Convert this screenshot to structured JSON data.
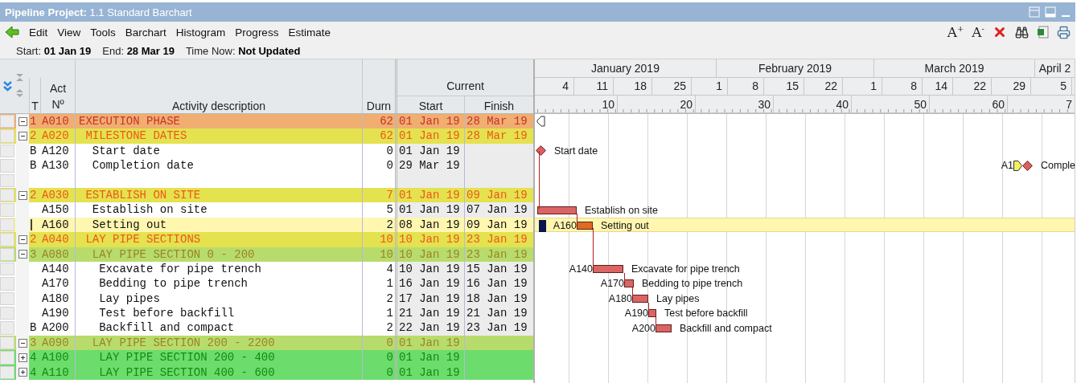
{
  "window": {
    "title": "**Pipeline Project:** 1.1 Standard Barchart"
  },
  "menu": [
    "Edit",
    "View",
    "Tools",
    "Barchart",
    "Histogram",
    "Progress",
    "Estimate"
  ],
  "toolbar": [
    {
      "kind": "text",
      "label": "A$^{+}$"
    },
    {
      "kind": "text",
      "label": "A$^{-}$"
    },
    {
      "kind": "delete"
    },
    {
      "kind": "find"
    },
    {
      "kind": "excel"
    },
    {
      "kind": "print"
    }
  ],
  "info": [
    {
      "label": "Start:",
      "value": "01 Jan 19"
    },
    {
      "label": "End:",
      "value": "28 Mar 19"
    },
    {
      "label": "Time Now:",
      "value": "Not Updated"
    }
  ],
  "table": {
    "columns": {
      "t": "T",
      "act": [
        "Act",
        "Nº"
      ],
      "description": "Activity description",
      "durn": "Durn",
      "group": "Current",
      "start": "Start",
      "finish": "Finish"
    }
  },
  "rows": [
    {
      "kind": "phase",
      "expanded": true,
      "selected": false,
      "t": "1",
      "act": "A010",
      "description": "EXECUTION PHASE",
      "durn": "62",
      "start": "01 Jan 19",
      "finish": "28 Mar 19",
      "bar": {
        "kind": "summary-start"
      },
      "children": [
        {
          "kind": "group",
          "expanded": true,
          "selected": false,
          "t": "2",
          "act": "A020",
          "description": "MILESTONE DATES",
          "durn": "62",
          "start": "01 Jan 19",
          "finish": "28 Mar 19",
          "children": [
            {
              "kind": "activity",
              "selected": false,
              "t": "B",
              "act": "A120",
              "description": "Start date",
              "durn": "0",
              "start": "01 Jan 19",
              "bar": {
                "kind": "milestone",
                "right_label": "Start date"
              }
            },
            {
              "kind": "activity",
              "selected": false,
              "t": "B",
              "act": "A130",
              "description": "Completion date",
              "durn": "0",
              "start": "29 Mar 19",
              "bar": {
                "kind": "late-milestone",
                "left_label": "A1",
                "right_label": "Comple"
              }
            }
          ]
        },
        {
          "kind": "blank",
          "selected": false
        },
        {
          "kind": "group",
          "expanded": true,
          "selected": false,
          "t": "2",
          "act": "A030",
          "description": "ESTABLISH ON SITE",
          "durn": "7",
          "start": "01 Jan 19",
          "finish": "09 Jan 19",
          "children": [
            {
              "kind": "activity",
              "selected": false,
              "act": "A150",
              "description": "Establish on site",
              "durn": "5",
              "start": "01 Jan 19",
              "finish": "07 Jan 19",
              "bar": {
                "kind": "bar",
                "right_label": "Establish on site"
              }
            },
            {
              "kind": "activity",
              "selected": true,
              "act": "A160",
              "description": "Setting out",
              "durn": "2",
              "start": "08 Jan 19",
              "finish": "09 Jan 19",
              "bar": {
                "kind": "progress-bar",
                "left_label": "A160",
                "right_label": "Setting out"
              }
            }
          ]
        },
        {
          "kind": "group",
          "expanded": true,
          "selected": false,
          "t": "2",
          "act": "A040",
          "description": "LAY PIPE SECTIONS",
          "durn": "10",
          "start": "10 Jan 19",
          "finish": "23 Jan 19",
          "children": [
            {
              "kind": "section",
              "expanded": true,
              "selected": false,
              "t": "3",
              "act": "A080",
              "description": "LAY PIPE SECTION 0 - 200",
              "durn": "10",
              "start": "10 Jan 19",
              "finish": "23 Jan 19",
              "children": [
                {
                  "kind": "activity",
                  "selected": false,
                  "act": "A140",
                  "description": "Excavate for pipe trench",
                  "durn": "4",
                  "start": "10 Jan 19",
                  "finish": "15 Jan 19",
                  "bar": {
                    "kind": "bar",
                    "left_label": "A140",
                    "right_label": "Excavate for pipe trench"
                  }
                },
                {
                  "kind": "activity",
                  "selected": false,
                  "act": "A170",
                  "description": "Bedding to pipe trench",
                  "durn": "1",
                  "start": "16 Jan 19",
                  "finish": "16 Jan 19",
                  "bar": {
                    "kind": "bar",
                    "left_label": "A170",
                    "right_label": "Bedding to pipe trench"
                  }
                },
                {
                  "kind": "activity",
                  "selected": false,
                  "act": "A180",
                  "description": "Lay pipes",
                  "durn": "2",
                  "start": "17 Jan 19",
                  "finish": "18 Jan 19",
                  "bar": {
                    "kind": "bar",
                    "left_label": "A180",
                    "right_label": "Lay pipes"
                  }
                },
                {
                  "kind": "activity",
                  "selected": false,
                  "act": "A190",
                  "description": "Test before backfill",
                  "durn": "1",
                  "start": "21 Jan 19",
                  "finish": "21 Jan 19",
                  "bar": {
                    "kind": "bar",
                    "left_label": "A190",
                    "right_label": "Test before backfill"
                  }
                },
                {
                  "kind": "activity",
                  "selected": false,
                  "t": "B",
                  "act": "A200",
                  "description": "Backfill and compact",
                  "durn": "2",
                  "start": "22 Jan 19",
                  "finish": "23 Jan 19",
                  "bar": {
                    "kind": "bar",
                    "left_label": "A200",
                    "right_label": "Backfill and compact"
                  }
                }
              ]
            },
            {
              "kind": "section",
              "expanded": true,
              "selected": false,
              "t": "3",
              "act": "A090",
              "description": "LAY PIPE SECTION 200 - 2200",
              "durn": "0",
              "start": "01 Jan 19",
              "children": [
                {
                  "kind": "subsection",
                  "expanded": false,
                  "selected": false,
                  "t": "4",
                  "act": "A100",
                  "description": "LAY PIPE SECTION 200 - 400",
                  "durn": "0",
                  "start": "01 Jan 19"
                },
                {
                  "kind": "subsection",
                  "expanded": false,
                  "selected": false,
                  "t": "4",
                  "act": "A110",
                  "description": "LAY PIPE SECTION 400 - 600",
                  "durn": "0",
                  "start": "01 Jan 19"
                }
              ]
            }
          ]
        }
      ]
    }
  ],
  "gantt": {
    "months": [
      "January 2019",
      "February 2019",
      "March 2019",
      "April 2"
    ],
    "weeks": [
      "4",
      "11",
      "18",
      "25",
      "1",
      "8",
      "15",
      "22",
      "1",
      "8",
      "14",
      "22",
      "29",
      "5"
    ],
    "scale": [
      "10",
      "20",
      "30",
      "40",
      "50",
      "60",
      "7"
    ]
  }
}
